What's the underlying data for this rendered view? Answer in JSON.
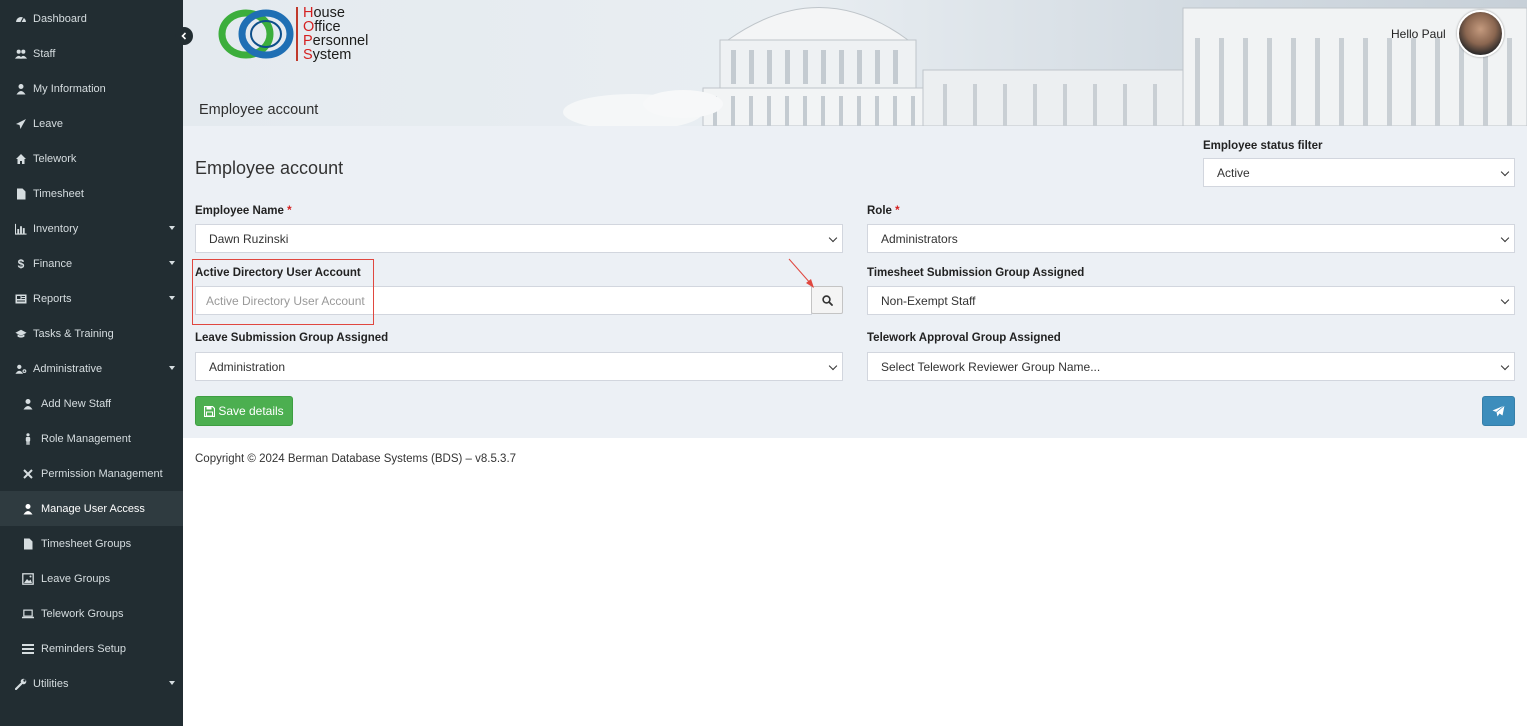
{
  "sidebar": {
    "items": [
      {
        "label": "Dashboard",
        "icon": "dashboard-icon"
      },
      {
        "label": "Staff",
        "icon": "users-icon"
      },
      {
        "label": "My Information",
        "icon": "user-icon"
      },
      {
        "label": "Leave",
        "icon": "plane-icon"
      },
      {
        "label": "Telework",
        "icon": "home-icon"
      },
      {
        "label": "Timesheet",
        "icon": "file-icon"
      },
      {
        "label": "Inventory",
        "icon": "bar-chart-icon"
      },
      {
        "label": "Finance",
        "icon": "dollar-icon"
      },
      {
        "label": "Reports",
        "icon": "newspaper-icon"
      },
      {
        "label": "Tasks & Training",
        "icon": "graduation-cap-icon"
      },
      {
        "label": "Administrative",
        "icon": "user-cog-icon"
      },
      {
        "label": "Add New Staff",
        "icon": "user-icon"
      },
      {
        "label": "Role Management",
        "icon": "person-icon"
      },
      {
        "label": "Permission Management",
        "icon": "x-icon"
      },
      {
        "label": "Manage User Access",
        "icon": "user-icon"
      },
      {
        "label": "Timesheet Groups",
        "icon": "file-icon"
      },
      {
        "label": "Leave Groups",
        "icon": "image-icon"
      },
      {
        "label": "Telework Groups",
        "icon": "laptop-icon"
      },
      {
        "label": "Reminders Setup",
        "icon": "list-icon"
      },
      {
        "label": "Utilities",
        "icon": "wrench-icon"
      }
    ]
  },
  "header": {
    "logo_lines": [
      {
        "first": "H",
        "rest": "ouse"
      },
      {
        "first": "O",
        "rest": "ffice"
      },
      {
        "first": "P",
        "rest": "ersonnel"
      },
      {
        "first": "S",
        "rest": "ystem"
      }
    ],
    "banner_title": "Employee account",
    "greeting": "Hello Paul"
  },
  "form": {
    "page_title": "Employee account",
    "status_filter": {
      "label": "Employee status filter",
      "value": "Active"
    },
    "employee_name": {
      "label": "Employee Name",
      "required_mark": "*",
      "value": "Dawn Ruzinski"
    },
    "role": {
      "label": "Role",
      "required_mark": "*",
      "value": "Administrators"
    },
    "ad_account": {
      "label": "Active Directory User Account",
      "placeholder": "Active Directory User Account"
    },
    "timesheet_group": {
      "label": "Timesheet Submission Group Assigned",
      "value": "Non-Exempt Staff"
    },
    "leave_group": {
      "label": "Leave Submission Group Assigned",
      "value": "Administration"
    },
    "telework_group": {
      "label": "Telework Approval Group Assigned",
      "value": "Select Telework Reviewer Group Name..."
    },
    "save_label": "Save details"
  },
  "footer": {
    "copyright": "Copyright © 2024 Berman Database Systems (BDS) – v8.5.3.7"
  },
  "colors": {
    "sidebar_bg": "#222d32",
    "content_bg": "#ecf0f5",
    "save_green": "#4caf50",
    "send_blue": "#3c8dbc",
    "required_red": "#d42020",
    "highlight_red": "#e0473f"
  }
}
